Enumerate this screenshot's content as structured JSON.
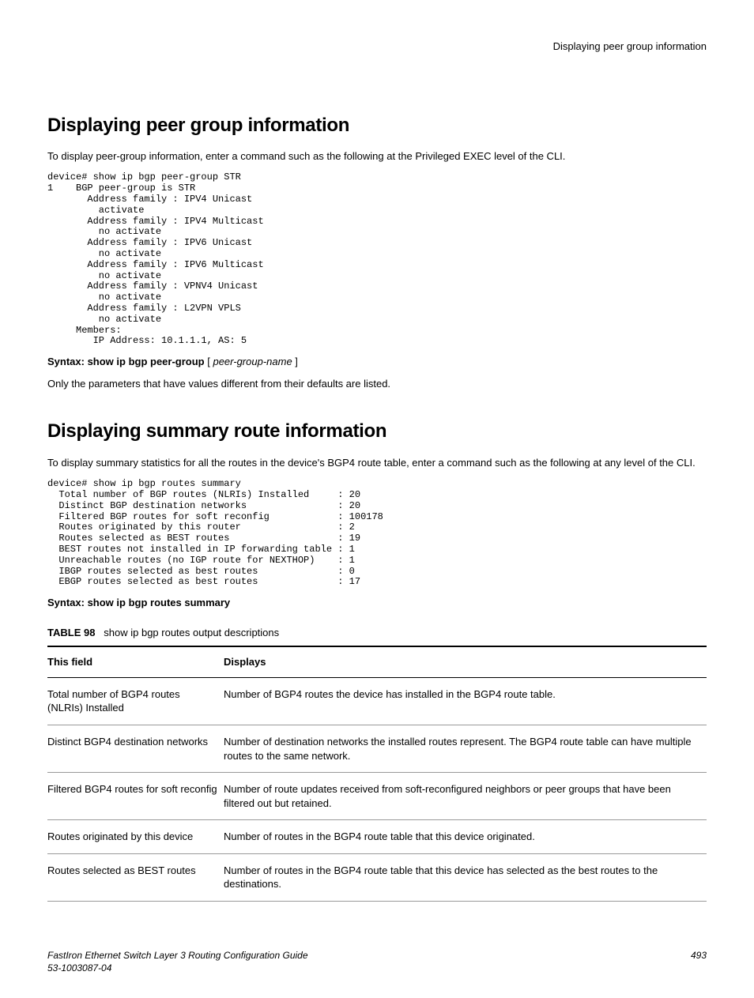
{
  "header": {
    "title": "Displaying peer group information"
  },
  "section1": {
    "heading": "Displaying peer group information",
    "intro": "To display peer-group information, enter a command such as the following at the Privileged EXEC level of the CLI.",
    "cli": "device# show ip bgp peer-group STR\n1    BGP peer-group is STR\n       Address family : IPV4 Unicast\n         activate\n       Address family : IPV4 Multicast\n         no activate\n       Address family : IPV6 Unicast\n         no activate\n       Address family : IPV6 Multicast\n         no activate\n       Address family : VPNV4 Unicast\n         no activate\n       Address family : L2VPN VPLS\n         no activate\n     Members:\n        IP Address: 10.1.1.1, AS: 5",
    "syntax_label": "Syntax: show ip bgp peer-group",
    "syntax_open": " [ ",
    "syntax_var": "peer-group-name",
    "syntax_close": " ]",
    "note": "Only the parameters that have values different from their defaults are listed."
  },
  "section2": {
    "heading": "Displaying summary route information",
    "intro": "To display summary statistics for all the routes in the device's BGP4 route table, enter a command such as the following at any level of the CLI.",
    "cli": "device# show ip bgp routes summary\n  Total number of BGP routes (NLRIs) Installed     : 20\n  Distinct BGP destination networks                : 20\n  Filtered BGP routes for soft reconfig            : 100178\n  Routes originated by this router                 : 2\n  Routes selected as BEST routes                   : 19\n  BEST routes not installed in IP forwarding table : 1\n  Unreachable routes (no IGP route for NEXTHOP)    : 1\n  IBGP routes selected as best routes              : 0\n  EBGP routes selected as best routes              : 17",
    "syntax_label": "Syntax: show ip bgp routes summary",
    "table_label": "TABLE 98",
    "table_caption": "show ip bgp routes output descriptions",
    "table_header": {
      "col1": "This field",
      "col2": "Displays"
    },
    "rows": [
      {
        "field": "Total number of BGP4 routes (NLRIs) Installed",
        "desc": "Number of BGP4 routes the device has installed in the BGP4 route table."
      },
      {
        "field": "Distinct BGP4 destination networks",
        "desc": "Number of destination networks the installed routes represent. The BGP4 route table can have multiple routes to the same network."
      },
      {
        "field": "Filtered BGP4 routes for soft reconfig",
        "desc": "Number of route updates received from soft-reconfigured neighbors or peer groups that have been filtered out but retained."
      },
      {
        "field": "Routes originated by this device",
        "desc": "Number of routes in the BGP4 route table that this device originated."
      },
      {
        "field": "Routes selected as BEST routes",
        "desc": "Number of routes in the BGP4 route table that this device has selected as the best routes to the destinations."
      }
    ]
  },
  "footer": {
    "doc_title": "FastIron Ethernet Switch Layer 3 Routing Configuration Guide",
    "doc_id": "53-1003087-04",
    "page": "493"
  }
}
